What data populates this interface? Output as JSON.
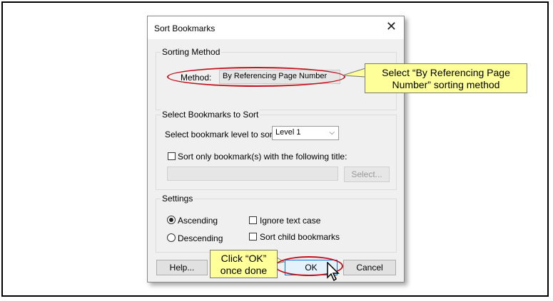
{
  "dialog": {
    "title": "Sort Bookmarks",
    "close_icon": "close-icon"
  },
  "sorting_method": {
    "group_label": "Sorting Method",
    "method_label": "Method:",
    "method_value": "By Referencing Page Number"
  },
  "select_bookmarks": {
    "group_label": "Select Bookmarks to Sort",
    "level_label": "Select bookmark level to sort:",
    "level_value": "Level 1",
    "title_checkbox_label": "Sort only bookmark(s) with the following title:",
    "title_checked": false,
    "select_button": "Select..."
  },
  "settings": {
    "group_label": "Settings",
    "ascending_label": "Ascending",
    "descending_label": "Descending",
    "ascending_selected": true,
    "ignore_case_label": "Ignore text case",
    "sort_child_label": "Sort child bookmarks"
  },
  "buttons": {
    "help": "Help...",
    "ok": "OK",
    "cancel": "Cancel"
  },
  "callouts": {
    "method_line1": "Select “By Referencing Page",
    "method_line2": "Number” sorting method",
    "ok_line1": "Click “OK”",
    "ok_line2": "once done"
  },
  "colors": {
    "callout_bg": "#ffff99",
    "highlight_ring": "#c0121b"
  }
}
